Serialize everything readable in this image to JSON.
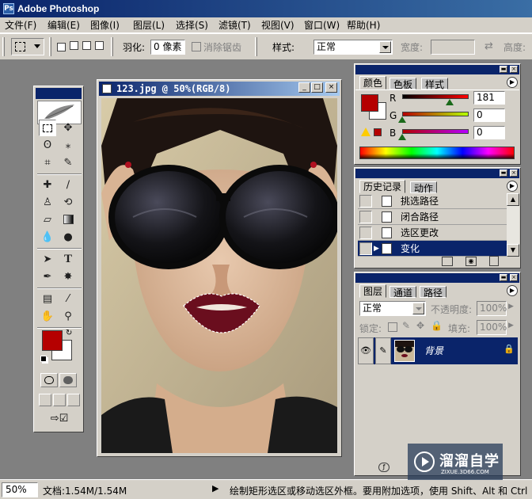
{
  "app": {
    "title": "Adobe Photoshop"
  },
  "menu": [
    "文件(F)",
    "编辑(E)",
    "图像(I)",
    "图层(L)",
    "选择(S)",
    "滤镜(T)",
    "视图(V)",
    "窗口(W)",
    "帮助(H)"
  ],
  "options": {
    "feather_label": "羽化:",
    "feather_value": "0 像素",
    "antialias_label": "消除锯齿",
    "style_label": "样式:",
    "style_value": "正常",
    "width_label": "宽度:",
    "height_label": "高度:"
  },
  "document": {
    "title": "123.jpg @ 50%(RGB/8)"
  },
  "color_panel": {
    "tabs": [
      "颜色",
      "色板",
      "样式"
    ],
    "r_label": "R",
    "r_value": "181",
    "g_label": "G",
    "g_value": "0",
    "b_label": "B",
    "b_value": "0",
    "r_level": 0.71,
    "g_level": 0.0,
    "b_level": 0.0,
    "swatch_color": "#b50000"
  },
  "history_panel": {
    "tabs": [
      "历史记录",
      "动作"
    ],
    "items": [
      {
        "label": "挑选路径",
        "selected": false
      },
      {
        "label": "闭合路径",
        "selected": false
      },
      {
        "label": "选区更改",
        "selected": false
      },
      {
        "label": "变化",
        "selected": true
      }
    ]
  },
  "layers_panel": {
    "tabs": [
      "图层",
      "通道",
      "路径"
    ],
    "blend_mode": "正常",
    "opacity_label": "不透明度:",
    "opacity_value": "100%",
    "lock_label": "锁定:",
    "fill_label": "填充:",
    "fill_value": "100%",
    "layer_name": "背景"
  },
  "status": {
    "zoom": "50%",
    "doc_info": "文档:1.54M/1.54M",
    "hint": "绘制矩形选区或移动选区外框。要用附加选项，使用 Shift、Alt 和 Ctrl 键。"
  },
  "watermark": {
    "text": "溜溜自学",
    "url": "ZIXUE.3D66.COM"
  },
  "colors": {
    "foreground": "#b50000",
    "background": "#ffffff",
    "selection": "#0a246a"
  }
}
